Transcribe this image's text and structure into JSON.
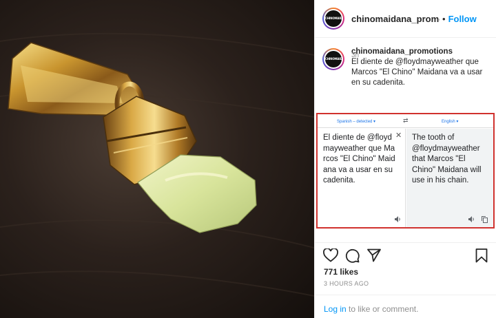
{
  "post": {
    "username": "chinomaidana_promotions",
    "header_username": "chinomaidana_promotior",
    "dot": "•",
    "follow_label": "Follow",
    "avatar_text": "CHINOMAIDANA",
    "caption": "El diente de @floydmayweather que Marcos \"El Chino\" Maidana va a usar en su cadenita.",
    "time_ago": "3h"
  },
  "translator": {
    "source_lang": "Spanish – detected ▾",
    "target_lang": "English ▾",
    "swap_symbol": "⇄",
    "close_symbol": "✕",
    "source_text": "El diente de @floydmayweather que Marcos \"El Chino\" Maidana va a usar en su cadenita.",
    "target_text": "The tooth of @floydmayweather that Marcos \"El Chino\" Maidana will use in his chain."
  },
  "engagement": {
    "likes": "771 likes",
    "timestamp": "3 HOURS AGO"
  },
  "login": {
    "link_label": "Log in",
    "rest": " to like or comment."
  },
  "colors": {
    "link_blue": "#0095f6",
    "translate_border": "#d0312d",
    "translate_blue": "#1a73e8"
  },
  "icons": [
    "heart-icon",
    "comment-icon",
    "share-icon",
    "bookmark-icon",
    "speaker-icon",
    "copy-icon",
    "swap-icon",
    "close-icon"
  ]
}
